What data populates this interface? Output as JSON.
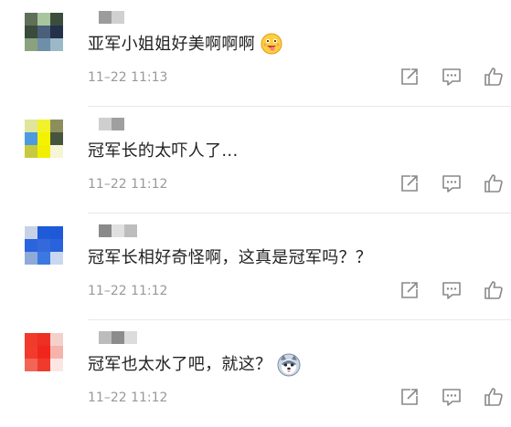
{
  "comments": [
    {
      "text": "亚军小姐姐好美啊啊啊",
      "time": "11–22 11:13",
      "emoji": "drooling-face-icon",
      "avatar_colors": [
        "#5f6f58",
        "#a9c59e",
        "#3c4d3e",
        "#394b3a",
        "#4a5f7a",
        "#23314a",
        "#8ba27f",
        "#6d8fa8",
        "#9bb8c8"
      ],
      "name_colors": [
        "#9c9c9c",
        "#d0d0d0"
      ]
    },
    {
      "text": "冠军长的太吓人了...",
      "time": "11–22 11:12",
      "emoji": "",
      "avatar_colors": [
        "#dfe59c",
        "#f2f22a",
        "#8c8f5c",
        "#4c9be0",
        "#f5f200",
        "#46563e",
        "#c7c940",
        "#f1ef00",
        "#f5f5d8"
      ],
      "name_colors": [
        "#cfcfcf",
        "#9f9f9f"
      ]
    },
    {
      "text": "冠军长相好奇怪啊，这真是冠军吗？？",
      "time": "11–22 11:12",
      "emoji": "",
      "avatar_colors": [
        "#c8d2e6",
        "#1f5bd9",
        "#1e5ad8",
        "#2a64df",
        "#3469d9",
        "#2863dc",
        "#8fa9d8",
        "#3b78e2",
        "#c9d8f0"
      ],
      "name_colors": [
        "#8a8a8a",
        "#e0e0e0",
        "#bdbdbd"
      ]
    },
    {
      "text": "冠军也太水了吧，就这？",
      "time": "11–22 11:12",
      "emoji": "husky-icon",
      "avatar_colors": [
        "#f03a2a",
        "#ee2f23",
        "#f4d0ca",
        "#f23b2c",
        "#f0261c",
        "#f5b3ab",
        "#f26455",
        "#ef3a2c",
        "#fbe6e3"
      ],
      "name_colors": [
        "#bcbcbc",
        "#8c8c8c",
        "#dcdcdc"
      ]
    }
  ],
  "action_icons": [
    "share-icon",
    "reply-icon",
    "like-icon"
  ]
}
